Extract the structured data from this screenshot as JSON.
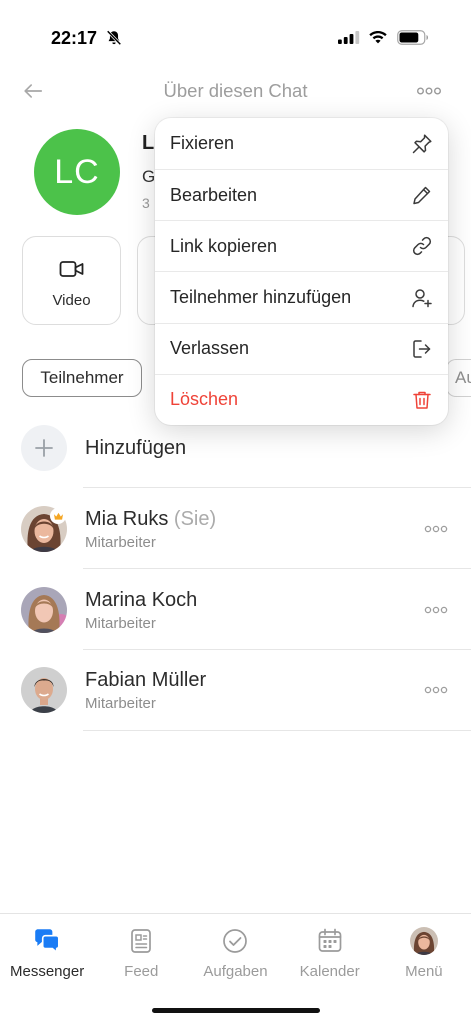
{
  "status_bar": {
    "time": "22:17",
    "mute_icon": "bell-slash-icon",
    "signal_icon": "cellular-signal-icon",
    "wifi_icon": "wifi-icon",
    "battery_icon": "battery-icon",
    "battery_level": 0.8
  },
  "header": {
    "title": "Über diesen Chat",
    "back_icon": "back-arrow-icon",
    "more_icon": "more-dots-icon"
  },
  "chat": {
    "initials": "LC",
    "name": "L",
    "description": "G",
    "meta": "3"
  },
  "actions": [
    {
      "label": "Video",
      "icon": "video-icon"
    }
  ],
  "chips": [
    {
      "label": "Teilnehmer",
      "selected": true
    },
    {
      "label": "Au",
      "selected": false
    }
  ],
  "add_member": {
    "label": "Hinzufügen",
    "icon": "plus-icon"
  },
  "members": [
    {
      "name": "Mia Ruks",
      "suffix": "(Sie)",
      "role": "Mitarbeiter",
      "badge_icon": "crown-icon",
      "more_icon": "more-dots-icon"
    },
    {
      "name": "Marina Koch",
      "role": "Mitarbeiter",
      "more_icon": "more-dots-icon"
    },
    {
      "name": "Fabian Müller",
      "role": "Mitarbeiter",
      "more_icon": "more-dots-icon"
    }
  ],
  "menu": {
    "items": [
      {
        "label": "Fixieren",
        "icon": "pin-icon"
      },
      {
        "label": "Bearbeiten",
        "icon": "pencil-icon"
      },
      {
        "label": "Link kopieren",
        "icon": "link-icon"
      },
      {
        "label": "Teilnehmer hinzufügen",
        "icon": "person-add-icon"
      },
      {
        "label": "Verlassen",
        "icon": "leave-icon"
      },
      {
        "label": "Löschen",
        "icon": "trash-icon",
        "danger": true
      }
    ]
  },
  "tabs": [
    {
      "label": "Messenger",
      "icon": "chat-bubbles-icon",
      "active": true
    },
    {
      "label": "Feed",
      "icon": "feed-icon",
      "active": false
    },
    {
      "label": "Aufgaben",
      "icon": "check-circle-icon",
      "active": false
    },
    {
      "label": "Kalender",
      "icon": "calendar-icon",
      "active": false
    },
    {
      "label": "Menü",
      "icon": "profile-avatar-icon",
      "active": false
    }
  ],
  "colors": {
    "accent": "#1a7cf5",
    "danger": "#ef4338",
    "chat_avatar": "#4cc24a",
    "badge": "#f5a623"
  }
}
